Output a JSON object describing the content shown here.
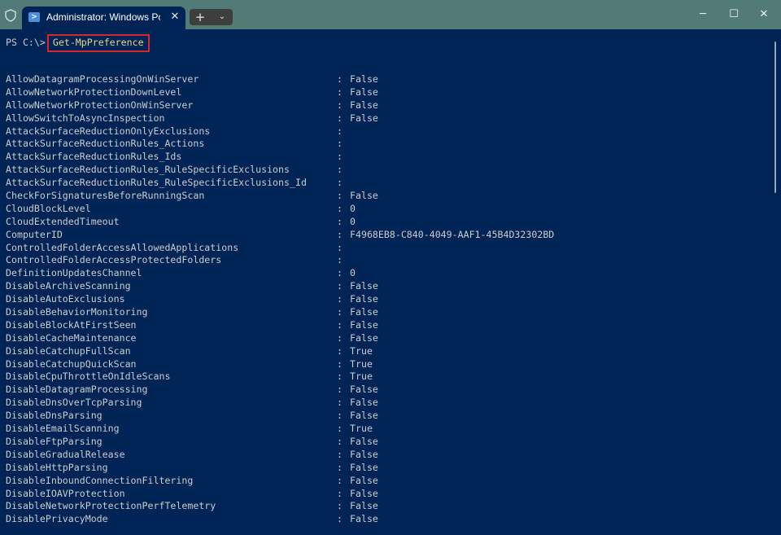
{
  "titlebar": {
    "tab_title": "Administrator: Windows PowerShell",
    "tab_close": "✕",
    "new_tab": "+",
    "dropdown": "⌄",
    "minimize": "─",
    "maximize": "☐",
    "close": "✕",
    "colors": {
      "titlebar": "#527a76",
      "terminal_bg": "#012456",
      "highlight": "#d9262e"
    }
  },
  "terminal": {
    "prompt": "PS C:\\>",
    "command": "Get-MpPreference",
    "separator": ":",
    "properties": [
      {
        "name": "AllowDatagramProcessingOnWinServer",
        "value": "False"
      },
      {
        "name": "AllowNetworkProtectionDownLevel",
        "value": "False"
      },
      {
        "name": "AllowNetworkProtectionOnWinServer",
        "value": "False"
      },
      {
        "name": "AllowSwitchToAsyncInspection",
        "value": "False"
      },
      {
        "name": "AttackSurfaceReductionOnlyExclusions",
        "value": ""
      },
      {
        "name": "AttackSurfaceReductionRules_Actions",
        "value": ""
      },
      {
        "name": "AttackSurfaceReductionRules_Ids",
        "value": ""
      },
      {
        "name": "AttackSurfaceReductionRules_RuleSpecificExclusions",
        "value": ""
      },
      {
        "name": "AttackSurfaceReductionRules_RuleSpecificExclusions_Id",
        "value": ""
      },
      {
        "name": "CheckForSignaturesBeforeRunningScan",
        "value": "False"
      },
      {
        "name": "CloudBlockLevel",
        "value": "0"
      },
      {
        "name": "CloudExtendedTimeout",
        "value": "0"
      },
      {
        "name": "ComputerID",
        "value": "F4968EB8-C840-4049-AAF1-45B4D32302BD"
      },
      {
        "name": "ControlledFolderAccessAllowedApplications",
        "value": ""
      },
      {
        "name": "ControlledFolderAccessProtectedFolders",
        "value": ""
      },
      {
        "name": "DefinitionUpdatesChannel",
        "value": "0"
      },
      {
        "name": "DisableArchiveScanning",
        "value": "False"
      },
      {
        "name": "DisableAutoExclusions",
        "value": "False"
      },
      {
        "name": "DisableBehaviorMonitoring",
        "value": "False"
      },
      {
        "name": "DisableBlockAtFirstSeen",
        "value": "False"
      },
      {
        "name": "DisableCacheMaintenance",
        "value": "False"
      },
      {
        "name": "DisableCatchupFullScan",
        "value": "True"
      },
      {
        "name": "DisableCatchupQuickScan",
        "value": "True"
      },
      {
        "name": "DisableCpuThrottleOnIdleScans",
        "value": "True"
      },
      {
        "name": "DisableDatagramProcessing",
        "value": "False"
      },
      {
        "name": "DisableDnsOverTcpParsing",
        "value": "False"
      },
      {
        "name": "DisableDnsParsing",
        "value": "False"
      },
      {
        "name": "DisableEmailScanning",
        "value": "True"
      },
      {
        "name": "DisableFtpParsing",
        "value": "False"
      },
      {
        "name": "DisableGradualRelease",
        "value": "False"
      },
      {
        "name": "DisableHttpParsing",
        "value": "False"
      },
      {
        "name": "DisableInboundConnectionFiltering",
        "value": "False"
      },
      {
        "name": "DisableIOAVProtection",
        "value": "False"
      },
      {
        "name": "DisableNetworkProtectionPerfTelemetry",
        "value": "False"
      },
      {
        "name": "DisablePrivacyMode",
        "value": "False"
      }
    ]
  }
}
